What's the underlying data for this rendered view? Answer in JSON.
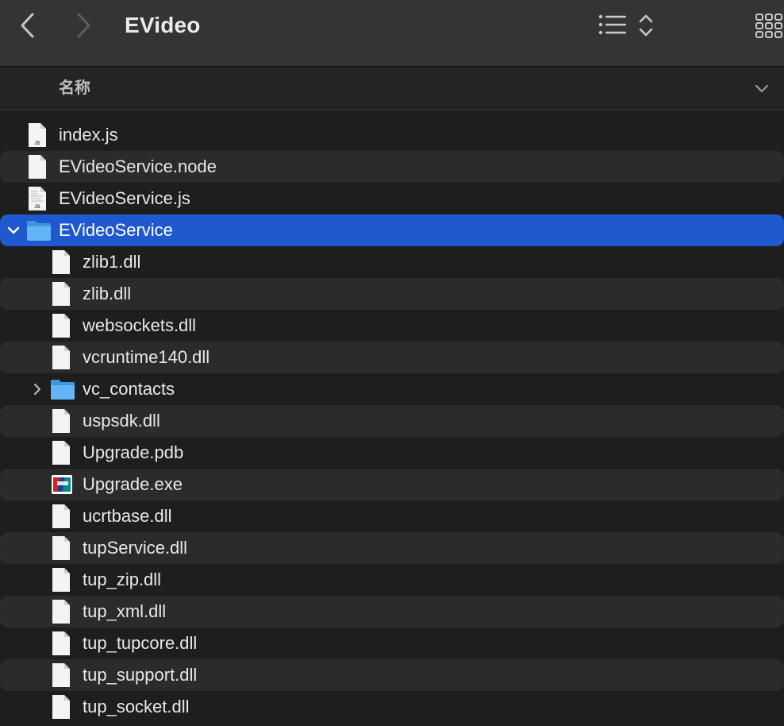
{
  "window": {
    "title": "EVideo"
  },
  "toolbar": {
    "back_icon": "chevron-left-icon",
    "forward_icon": "chevron-right-icon",
    "list_view_icon": "list-icon",
    "sort_icon": "up-down-chevron-icon",
    "grid_view_icon": "grid-icon"
  },
  "column_header": {
    "name_label": "名称",
    "menu_icon": "chevron-down-icon"
  },
  "colors": {
    "background": "#1e1e1e",
    "row_alt": "#2b2b2b",
    "selection": "#1f59cf",
    "folder_blue": "#5bb3f5"
  },
  "files": [
    {
      "name": "index.js",
      "kind": "js",
      "depth": 0
    },
    {
      "name": "EVideoService.node",
      "kind": "doc",
      "depth": 0
    },
    {
      "name": "EVideoService.js",
      "kind": "js-lines",
      "depth": 0
    },
    {
      "name": "EVideoService",
      "kind": "folder",
      "depth": 0,
      "expanded": true,
      "selected": true
    },
    {
      "name": "zlib1.dll",
      "kind": "doc",
      "depth": 1
    },
    {
      "name": "zlib.dll",
      "kind": "doc",
      "depth": 1
    },
    {
      "name": "websockets.dll",
      "kind": "doc",
      "depth": 1
    },
    {
      "name": "vcruntime140.dll",
      "kind": "doc",
      "depth": 1
    },
    {
      "name": "vc_contacts",
      "kind": "folder",
      "depth": 1,
      "expanded": false
    },
    {
      "name": "uspsdk.dll",
      "kind": "doc",
      "depth": 1
    },
    {
      "name": "Upgrade.pdb",
      "kind": "doc",
      "depth": 1
    },
    {
      "name": "Upgrade.exe",
      "kind": "exe",
      "depth": 1
    },
    {
      "name": "ucrtbase.dll",
      "kind": "doc",
      "depth": 1
    },
    {
      "name": "tupService.dll",
      "kind": "doc",
      "depth": 1
    },
    {
      "name": "tup_zip.dll",
      "kind": "doc",
      "depth": 1
    },
    {
      "name": "tup_xml.dll",
      "kind": "doc",
      "depth": 1
    },
    {
      "name": "tup_tupcore.dll",
      "kind": "doc",
      "depth": 1
    },
    {
      "name": "tup_support.dll",
      "kind": "doc",
      "depth": 1
    },
    {
      "name": "tup_socket.dll",
      "kind": "doc",
      "depth": 1
    }
  ]
}
